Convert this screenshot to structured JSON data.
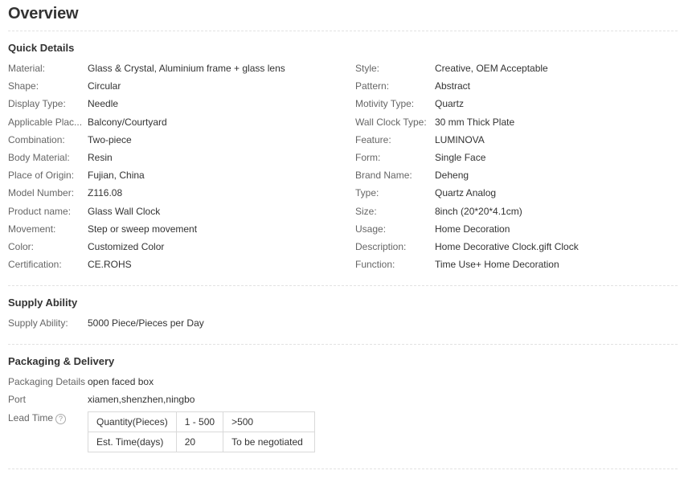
{
  "title": "Overview",
  "quick_details": {
    "heading": "Quick Details",
    "left": [
      {
        "label": "Material:",
        "value": "Glass & Crystal, Aluminium frame + glass lens"
      },
      {
        "label": "Shape:",
        "value": "Circular"
      },
      {
        "label": "Display Type:",
        "value": "Needle"
      },
      {
        "label": "Applicable Plac...",
        "value": "Balcony/Courtyard"
      },
      {
        "label": "Combination:",
        "value": "Two-piece"
      },
      {
        "label": "Body Material:",
        "value": "Resin"
      },
      {
        "label": "Place of Origin:",
        "value": "Fujian, China"
      },
      {
        "label": "Model Number:",
        "value": "Z116.08"
      },
      {
        "label": "Product name:",
        "value": "Glass Wall Clock"
      },
      {
        "label": "Movement:",
        "value": "Step or sweep movement"
      },
      {
        "label": "Color:",
        "value": "Customized Color"
      },
      {
        "label": "Certification:",
        "value": "CE.ROHS"
      }
    ],
    "right": [
      {
        "label": "Style:",
        "value": "Creative, OEM Acceptable"
      },
      {
        "label": "Pattern:",
        "value": "Abstract"
      },
      {
        "label": "Motivity Type:",
        "value": "Quartz"
      },
      {
        "label": "Wall Clock Type:",
        "value": "30 mm Thick Plate"
      },
      {
        "label": "Feature:",
        "value": "LUMINOVA"
      },
      {
        "label": "Form:",
        "value": "Single Face"
      },
      {
        "label": "Brand Name:",
        "value": "Deheng"
      },
      {
        "label": "Type:",
        "value": "Quartz Analog"
      },
      {
        "label": "Size:",
        "value": "8inch (20*20*4.1cm)"
      },
      {
        "label": "Usage:",
        "value": "Home Decoration"
      },
      {
        "label": "Description:",
        "value": "Home Decorative Clock.gift Clock"
      },
      {
        "label": "Function:",
        "value": "Time Use+ Home Decoration"
      }
    ]
  },
  "supply_ability": {
    "heading": "Supply Ability",
    "label": "Supply Ability:",
    "value": "5000 Piece/Pieces per Day"
  },
  "packaging": {
    "heading": "Packaging & Delivery",
    "details_label": "Packaging Details",
    "details_value": "open faced box",
    "port_label": "Port",
    "port_value": "xiamen,shenzhen,ningbo",
    "lead_time_label": "Lead Time",
    "help_icon_glyph": "?",
    "lead_table": {
      "row1": [
        "Quantity(Pieces)",
        "1 - 500",
        ">500"
      ],
      "row2": [
        "Est. Time(days)",
        "20",
        "To be negotiated"
      ]
    }
  }
}
